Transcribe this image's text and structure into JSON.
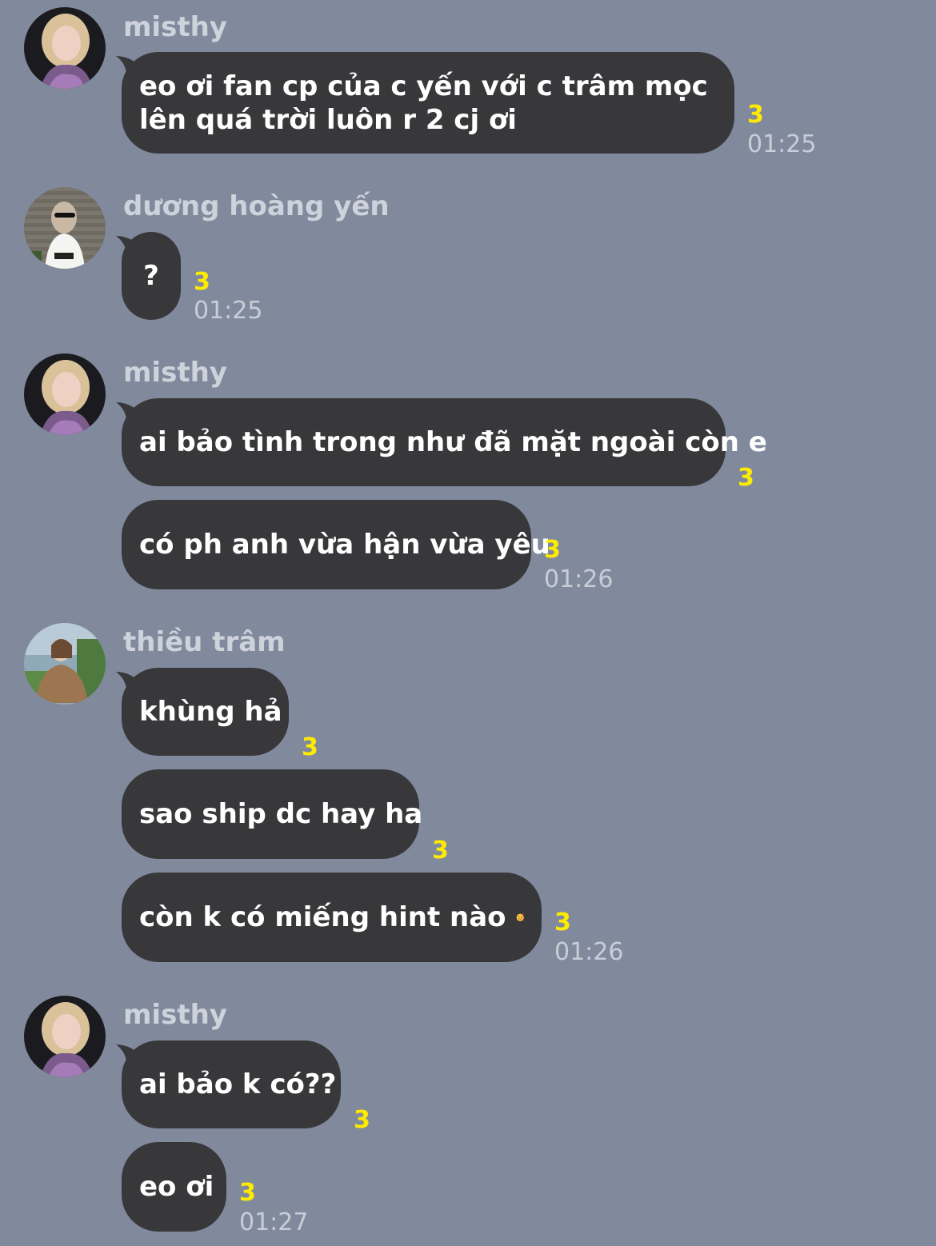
{
  "colors": {
    "background": "#808A9C",
    "bubble": "#38383B",
    "read_count": "#FFEB00",
    "timestamp": "#C8CED8",
    "sender": "#CDD2DB"
  },
  "groups": [
    {
      "sender": "misthy",
      "avatar_icon": "avatar-misthy",
      "messages": [
        {
          "text": "eo ơi fan cp của c yến với c trâm mọc lên quá trời luôn r 2 cj ơi",
          "read": "3",
          "time": "01:25"
        }
      ]
    },
    {
      "sender": "dương hoàng yến",
      "avatar_icon": "avatar-duong-hoang-yen",
      "messages": [
        {
          "text": "?",
          "read": "3",
          "time": "01:25"
        }
      ]
    },
    {
      "sender": "misthy",
      "avatar_icon": "avatar-misthy",
      "messages": [
        {
          "text": "ai bảo tình trong như đã mặt ngoài còn e",
          "read": "3"
        },
        {
          "text": "có ph anh vừa hận vừa yêu",
          "read": "3",
          "time": "01:26"
        }
      ]
    },
    {
      "sender": "thiều trâm",
      "avatar_icon": "avatar-thieu-tram",
      "messages": [
        {
          "text": "khùng hả",
          "read": "3"
        },
        {
          "text": "sao ship dc hay ha",
          "read": "3"
        },
        {
          "text": "còn k có miếng hint nào",
          "emoji": "smiling-face-with-hearts-icon",
          "read": "3",
          "time": "01:26"
        }
      ]
    },
    {
      "sender": "misthy",
      "avatar_icon": "avatar-misthy",
      "messages": [
        {
          "text": "ai bảo k có??",
          "read": "3"
        },
        {
          "text": "eo ơi",
          "read": "3",
          "time": "01:27"
        }
      ]
    }
  ]
}
